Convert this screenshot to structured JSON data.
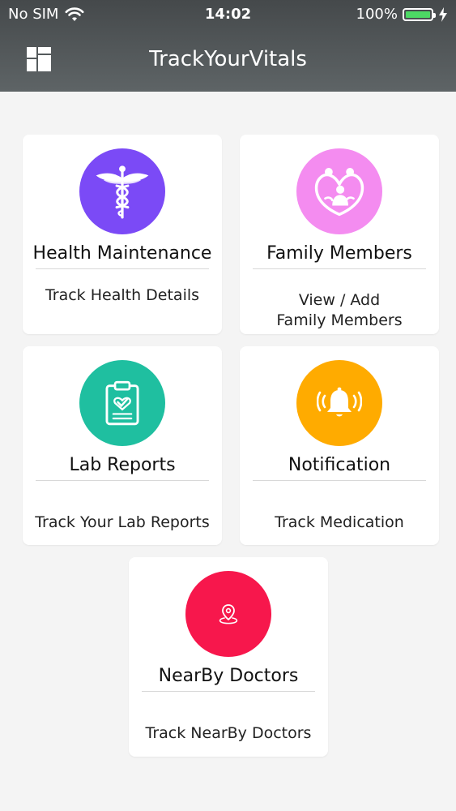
{
  "status_bar": {
    "carrier": "No SIM",
    "time": "14:02",
    "battery": "100%",
    "battery_level": 1.0
  },
  "header": {
    "title": "TrackYourVitals",
    "menu_icon": "grid-menu-icon"
  },
  "cards": [
    {
      "title": "Health Maintenance",
      "subtitle": "Track Health Details",
      "icon": "caduceus-icon",
      "color": "#7B4AF6"
    },
    {
      "title": "Family Members",
      "subtitle": "View / Add\nFamily Members",
      "icon": "family-icon",
      "color": "#F48CF0"
    },
    {
      "title": "Lab Reports",
      "subtitle": "Track Your Lab Reports",
      "icon": "clipboard-check-icon",
      "color": "#1FBFA0"
    },
    {
      "title": "Notification",
      "subtitle": "Track Medication",
      "icon": "ringing-bell-icon",
      "color": "#FFAB00"
    },
    {
      "title": "NearBy Doctors",
      "subtitle": "Track NearBy Doctors",
      "icon": "location-pin-icon",
      "color": "#F7174C"
    }
  ]
}
